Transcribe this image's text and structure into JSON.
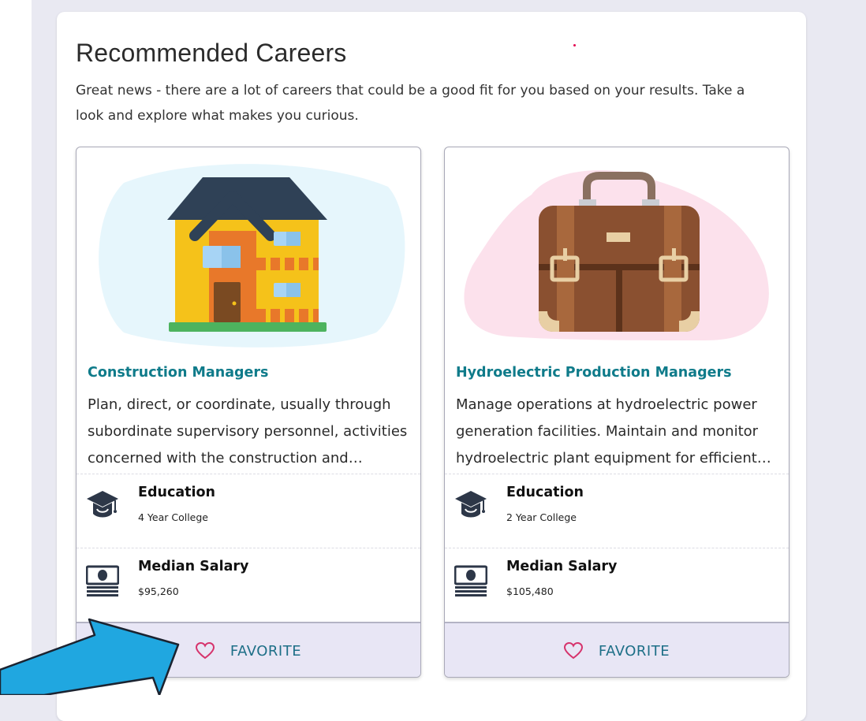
{
  "panel": {
    "title": "Recommended Careers",
    "description": "Great news - there are a lot of careers that could be a good fit for you based on your results. Take a look and explore what makes you curious."
  },
  "colors": {
    "accent_title": "#0f7b8a",
    "favorite_text": "#1d6f87",
    "favorite_heart": "#d6336c",
    "favorite_bar": "#e8e6f5",
    "arrow": "#20a7e0"
  },
  "careers": [
    {
      "illustration": "house-icon",
      "title": "Construction Managers",
      "description": "Plan, direct, or coordinate, usually through subordinate supervisory personnel, activities concerned with the construction and maintenance of structures, facilities, and systems.",
      "education_label": "Education",
      "education_value": "4 Year College",
      "salary_label": "Median Salary",
      "salary_value": "$95,260",
      "favorite_label": "FAVORITE"
    },
    {
      "illustration": "briefcase-icon",
      "title": "Hydroelectric Production Managers",
      "description": "Manage operations at hydroelectric power generation facilities. Maintain and monitor hydroelectric plant equipment for efficient and safe plant operations.",
      "education_label": "Education",
      "education_value": "2 Year College",
      "salary_label": "Median Salary",
      "salary_value": "$105,480",
      "favorite_label": "FAVORITE"
    }
  ]
}
